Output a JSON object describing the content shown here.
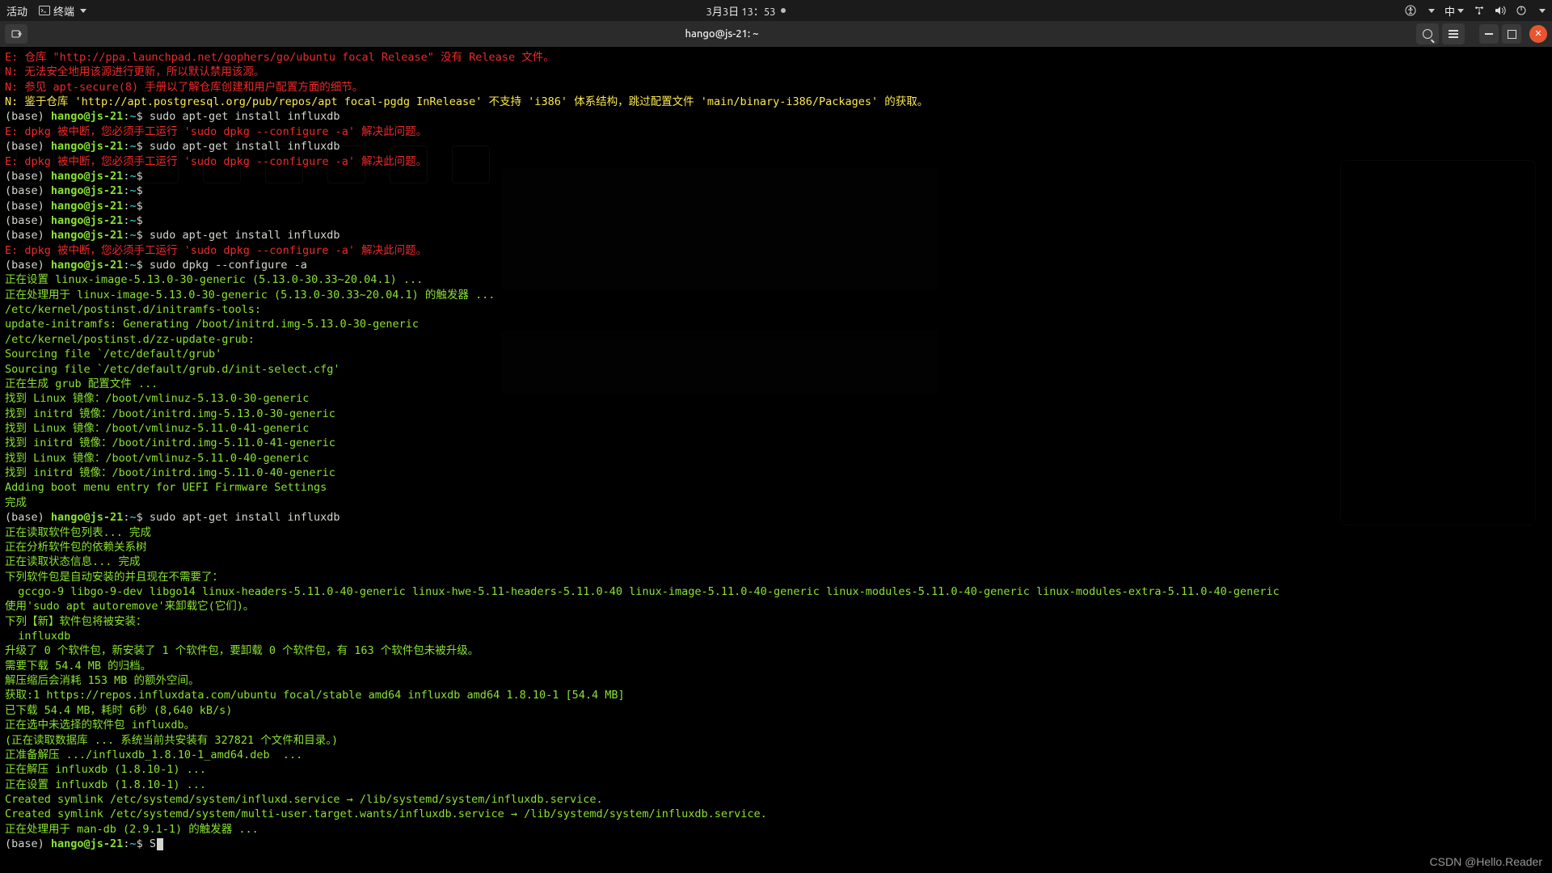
{
  "topbar": {
    "activities": "活动",
    "app": "终端",
    "datetime": "3月3日 13：53",
    "ime": "中"
  },
  "window": {
    "title": "hango@js-21: ~"
  },
  "prompt": {
    "base": "(base) ",
    "host": "hango@js-21",
    "sep1": ":",
    "path": "~",
    "sep2": "$"
  },
  "lines": [
    {
      "cls": "c-red",
      "t": "E: 仓库 \"http://ppa.launchpad.net/gophers/go/ubuntu focal Release\" 没有 Release 文件。"
    },
    {
      "cls": "c-red",
      "t": "N: 无法安全地用该源进行更新，所以默认禁用该源。"
    },
    {
      "cls": "c-red",
      "t": "N: 参见 apt-secure(8) 手册以了解仓库创建和用户配置方面的细节。"
    },
    {
      "cls": "c-yel",
      "t": "N: 鉴于仓库 'http://apt.postgresql.org/pub/repos/apt focal-pgdg InRelease' 不支持 'i386' 体系结构，跳过配置文件 'main/binary-i386/Packages' 的获取。"
    },
    {
      "prompt": true,
      "cmd": "sudo apt-get install influxdb"
    },
    {
      "cls": "c-red",
      "t": "E: dpkg 被中断，您必须手工运行 'sudo dpkg --configure -a' 解决此问题。"
    },
    {
      "prompt": true,
      "cmd": "sudo apt-get install influxdb"
    },
    {
      "cls": "c-red",
      "t": "E: dpkg 被中断，您必须手工运行 'sudo dpkg --configure -a' 解决此问题。"
    },
    {
      "prompt": true,
      "cmd": ""
    },
    {
      "prompt": true,
      "cmd": ""
    },
    {
      "prompt": true,
      "cmd": ""
    },
    {
      "prompt": true,
      "cmd": ""
    },
    {
      "prompt": true,
      "cmd": "sudo apt-get install influxdb"
    },
    {
      "cls": "c-red",
      "t": "E: dpkg 被中断，您必须手工运行 'sudo dpkg --configure -a' 解决此问题。"
    },
    {
      "prompt": true,
      "cmd": "sudo dpkg --configure -a"
    },
    {
      "cls": "c-grn",
      "t": "正在设置 linux-image-5.13.0-30-generic (5.13.0-30.33~20.04.1) ..."
    },
    {
      "cls": "c-grn",
      "t": "正在处理用于 linux-image-5.13.0-30-generic (5.13.0-30.33~20.04.1) 的触发器 ..."
    },
    {
      "cls": "c-grn",
      "t": "/etc/kernel/postinst.d/initramfs-tools:"
    },
    {
      "cls": "c-grn",
      "t": "update-initramfs: Generating /boot/initrd.img-5.13.0-30-generic"
    },
    {
      "cls": "c-grn",
      "t": "/etc/kernel/postinst.d/zz-update-grub:"
    },
    {
      "cls": "c-grn",
      "t": "Sourcing file `/etc/default/grub'"
    },
    {
      "cls": "c-grn",
      "t": "Sourcing file `/etc/default/grub.d/init-select.cfg'"
    },
    {
      "cls": "c-grn",
      "t": "正在生成 grub 配置文件 ..."
    },
    {
      "cls": "c-grn",
      "t": "找到 Linux 镜像：/boot/vmlinuz-5.13.0-30-generic"
    },
    {
      "cls": "c-grn",
      "t": "找到 initrd 镜像：/boot/initrd.img-5.13.0-30-generic"
    },
    {
      "cls": "c-grn",
      "t": "找到 Linux 镜像：/boot/vmlinuz-5.11.0-41-generic"
    },
    {
      "cls": "c-grn",
      "t": "找到 initrd 镜像：/boot/initrd.img-5.11.0-41-generic"
    },
    {
      "cls": "c-grn",
      "t": "找到 Linux 镜像：/boot/vmlinuz-5.11.0-40-generic"
    },
    {
      "cls": "c-grn",
      "t": "找到 initrd 镜像：/boot/initrd.img-5.11.0-40-generic"
    },
    {
      "cls": "c-grn",
      "t": "Adding boot menu entry for UEFI Firmware Settings"
    },
    {
      "cls": "c-grn",
      "t": "完成"
    },
    {
      "prompt": true,
      "cmd": "sudo apt-get install influxdb"
    },
    {
      "cls": "c-grn",
      "t": "正在读取软件包列表... 完成"
    },
    {
      "cls": "c-grn",
      "t": "正在分析软件包的依赖关系树"
    },
    {
      "cls": "c-grn",
      "t": "正在读取状态信息... 完成"
    },
    {
      "cls": "c-grn",
      "t": "下列软件包是自动安装的并且现在不需要了："
    },
    {
      "cls": "c-grn",
      "t": "  gccgo-9 libgo-9-dev libgo14 linux-headers-5.11.0-40-generic linux-hwe-5.11-headers-5.11.0-40 linux-image-5.11.0-40-generic linux-modules-5.11.0-40-generic linux-modules-extra-5.11.0-40-generic"
    },
    {
      "cls": "c-grn",
      "t": "使用'sudo apt autoremove'来卸载它(它们)。"
    },
    {
      "cls": "c-grn",
      "t": "下列【新】软件包将被安装："
    },
    {
      "cls": "c-grn",
      "t": "  influxdb"
    },
    {
      "cls": "c-grn",
      "t": "升级了 0 个软件包，新安装了 1 个软件包，要卸载 0 个软件包，有 163 个软件包未被升级。"
    },
    {
      "cls": "c-grn",
      "t": "需要下载 54.4 MB 的归档。"
    },
    {
      "cls": "c-grn",
      "t": "解压缩后会消耗 153 MB 的额外空间。"
    },
    {
      "cls": "c-grn",
      "t": "获取:1 https://repos.influxdata.com/ubuntu focal/stable amd64 influxdb amd64 1.8.10-1 [54.4 MB]"
    },
    {
      "cls": "c-grn",
      "t": "已下载 54.4 MB，耗时 6秒 (8,640 kB/s)"
    },
    {
      "cls": "c-grn",
      "t": "正在选中未选择的软件包 influxdb。"
    },
    {
      "cls": "c-grn",
      "t": "(正在读取数据库 ... 系统当前共安装有 327821 个文件和目录。)"
    },
    {
      "cls": "c-grn",
      "t": "正准备解压 .../influxdb_1.8.10-1_amd64.deb  ..."
    },
    {
      "cls": "c-grn",
      "t": "正在解压 influxdb (1.8.10-1) ..."
    },
    {
      "cls": "c-grn",
      "t": "正在设置 influxdb (1.8.10-1) ..."
    },
    {
      "cls": "c-grn",
      "t": "Created symlink /etc/systemd/system/influxd.service → /lib/systemd/system/influxdb.service."
    },
    {
      "cls": "c-grn",
      "t": "Created symlink /etc/systemd/system/multi-user.target.wants/influxdb.service → /lib/systemd/system/influxdb.service."
    },
    {
      "cls": "c-grn",
      "t": "正在处理用于 man-db (2.9.1-1) 的触发器 ..."
    },
    {
      "prompt": true,
      "cmd": "S",
      "cursor": true
    }
  ],
  "watermark": "CSDN @Hello.Reader"
}
